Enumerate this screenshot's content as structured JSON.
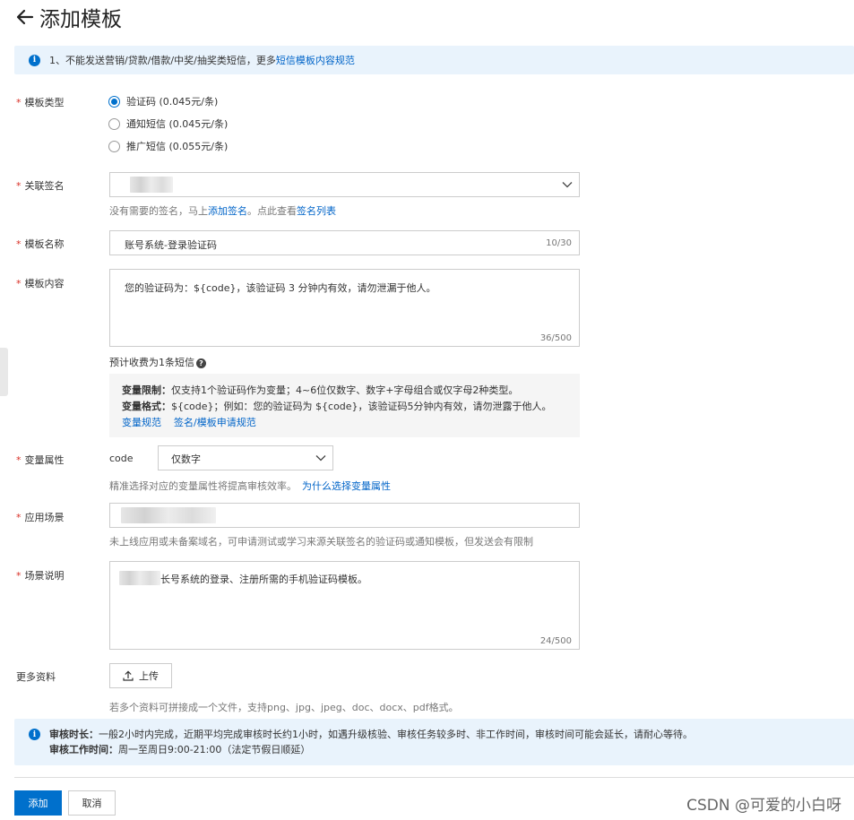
{
  "header": {
    "title": "添加模板"
  },
  "notice_top": {
    "text": "1、不能发送营销/贷款/借款/中奖/抽奖类短信，更多",
    "link": "短信模板内容规范"
  },
  "template_type": {
    "label": "模板类型",
    "options": [
      {
        "label": "验证码 (0.045元/条)",
        "selected": true
      },
      {
        "label": "通知短信 (0.045元/条)",
        "selected": false
      },
      {
        "label": "推广短信 (0.055元/条)",
        "selected": false
      }
    ]
  },
  "signature": {
    "label": "关联签名",
    "hint_prefix": "没有需要的签名，马上",
    "hint_link1": "添加签名",
    "hint_mid": "。点此查看",
    "hint_link2": "签名列表"
  },
  "template_name": {
    "label": "模板名称",
    "value": "账号系统-登录验证码",
    "counter": "10/30"
  },
  "template_content": {
    "label": "模板内容",
    "value": "您的验证码为：${code}，该验证码 3 分钟内有效，请勿泄漏于他人。",
    "counter": "36/500",
    "estimate": "预计收费为1条短信"
  },
  "variable_box": {
    "limit_title": "变量限制：",
    "limit_text": "仅支持1个验证码作为变量；4~6位仅数字、数字+字母组合或仅字母2种类型。",
    "format_title": "变量格式：",
    "format_text": "${code}；例如：您的验证码为 ${code}，该验证码5分钟内有效，请勿泄露于他人。",
    "link1": "变量规范",
    "link2": "签名/模板申请规范"
  },
  "variable_attr": {
    "label": "变量属性",
    "var_name": "code",
    "selected": "仅数字",
    "hint": "精准选择对应的变量属性将提高审核效率。",
    "hint_link": "为什么选择变量属性"
  },
  "scene": {
    "label": "应用场景",
    "hint": "未上线应用或未备案域名，可申请测试或学习来源关联签名的验证码或通知模板，但发送会有限制"
  },
  "scene_desc": {
    "label": "场景说明",
    "value": "长号系统的登录、注册所需的手机验证码模板。",
    "counter": "24/500"
  },
  "more_info": {
    "label": "更多资料",
    "upload_label": "上传",
    "hint": "若多个资料可拼接成一个文件，支持png、jpg、jpeg、doc、docx、pdf格式。"
  },
  "notice_bottom": {
    "title1": "审核时长：",
    "text1": "一般2小时内完成，近期平均完成审核时长约1小时，如遇升级核验、审核任务较多时、非工作时间，审核时间可能会延长，请耐心等待。",
    "title2": "审核工作时间：",
    "text2": "周一至周日9:00-21:00（法定节假日顺延）"
  },
  "actions": {
    "submit": "添加",
    "cancel": "取消"
  },
  "watermark": "CSDN @可爱的小白呀",
  "colors": {
    "primary": "#0070cc",
    "link": "#0064c8",
    "notice_bg": "#e9f3fc",
    "required": "#d93026"
  }
}
